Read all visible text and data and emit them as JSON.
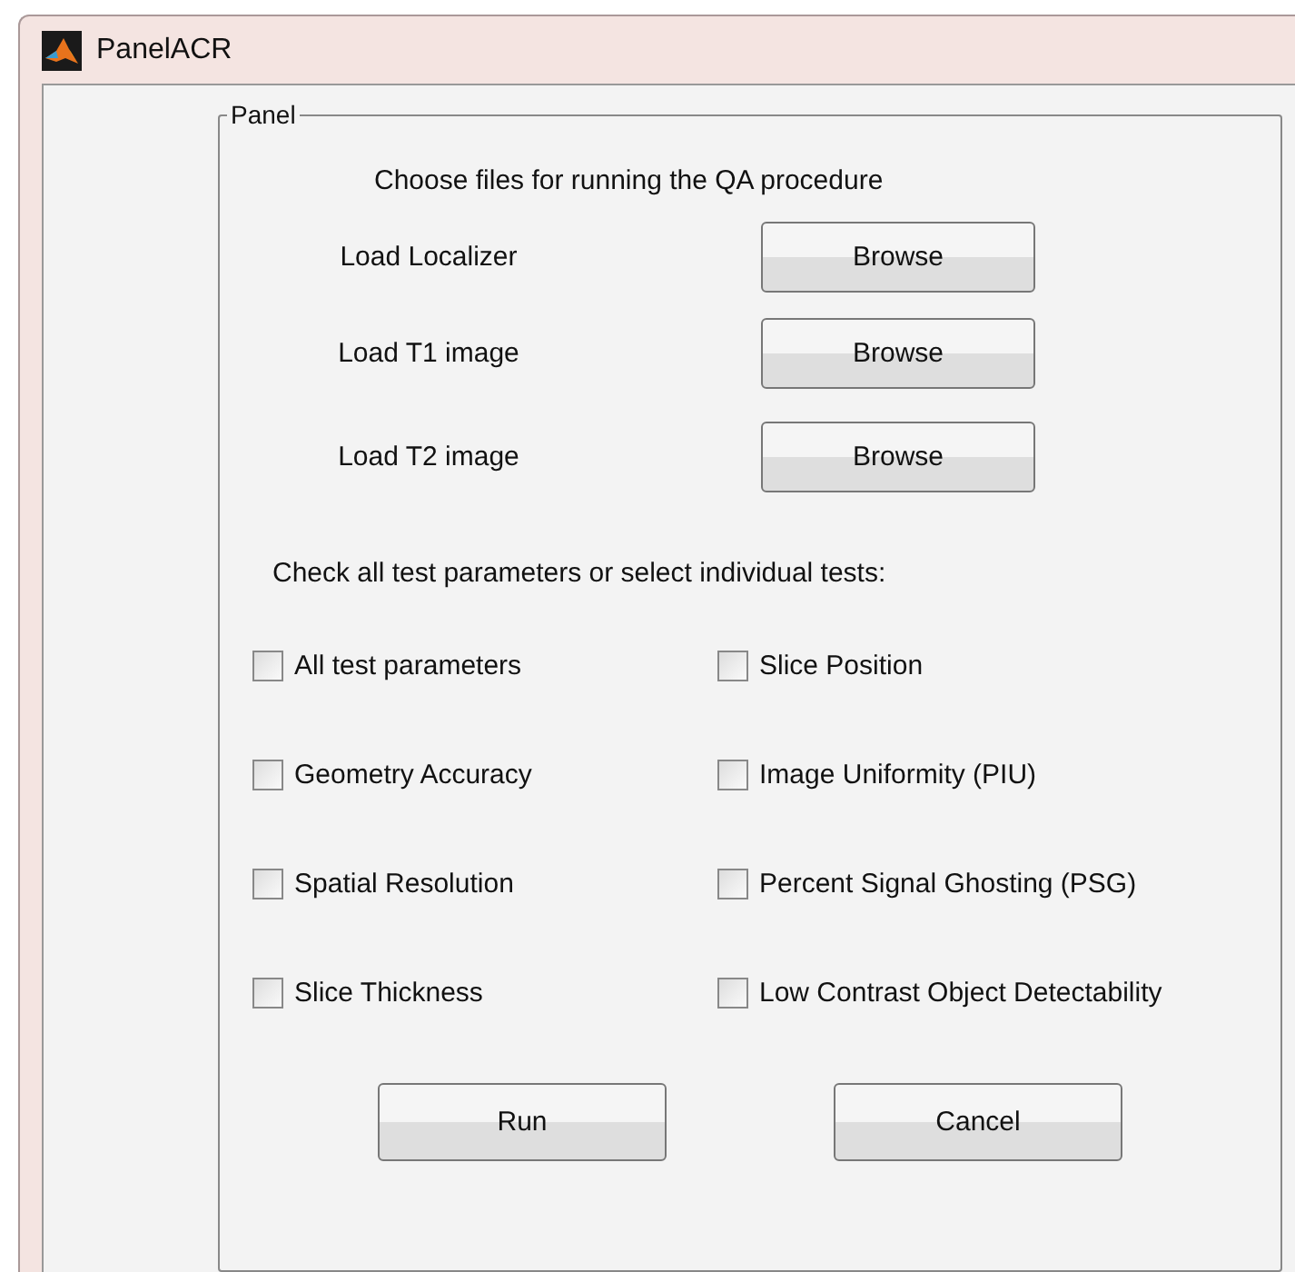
{
  "window": {
    "title": "PanelACR"
  },
  "panel": {
    "title": "Panel",
    "instruction": "Choose files for running the QA procedure",
    "file_rows": [
      {
        "label": "Load Localizer",
        "button": "Browse"
      },
      {
        "label": "Load T1 image",
        "button": "Browse"
      },
      {
        "label": "Load T2 image",
        "button": "Browse"
      }
    ],
    "tests_prompt": "Check all test parameters or select individual tests:",
    "tests": [
      {
        "label": "All test parameters",
        "checked": false
      },
      {
        "label": "Slice Position",
        "checked": false
      },
      {
        "label": "Geometry Accuracy",
        "checked": false
      },
      {
        "label": "Image Uniformity (PIU)",
        "checked": false
      },
      {
        "label": "Spatial Resolution",
        "checked": false
      },
      {
        "label": "Percent Signal Ghosting (PSG)",
        "checked": false
      },
      {
        "label": "Slice Thickness",
        "checked": false
      },
      {
        "label": "Low Contrast Object Detectability",
        "checked": false
      }
    ],
    "buttons": [
      "Run",
      "Cancel"
    ]
  }
}
